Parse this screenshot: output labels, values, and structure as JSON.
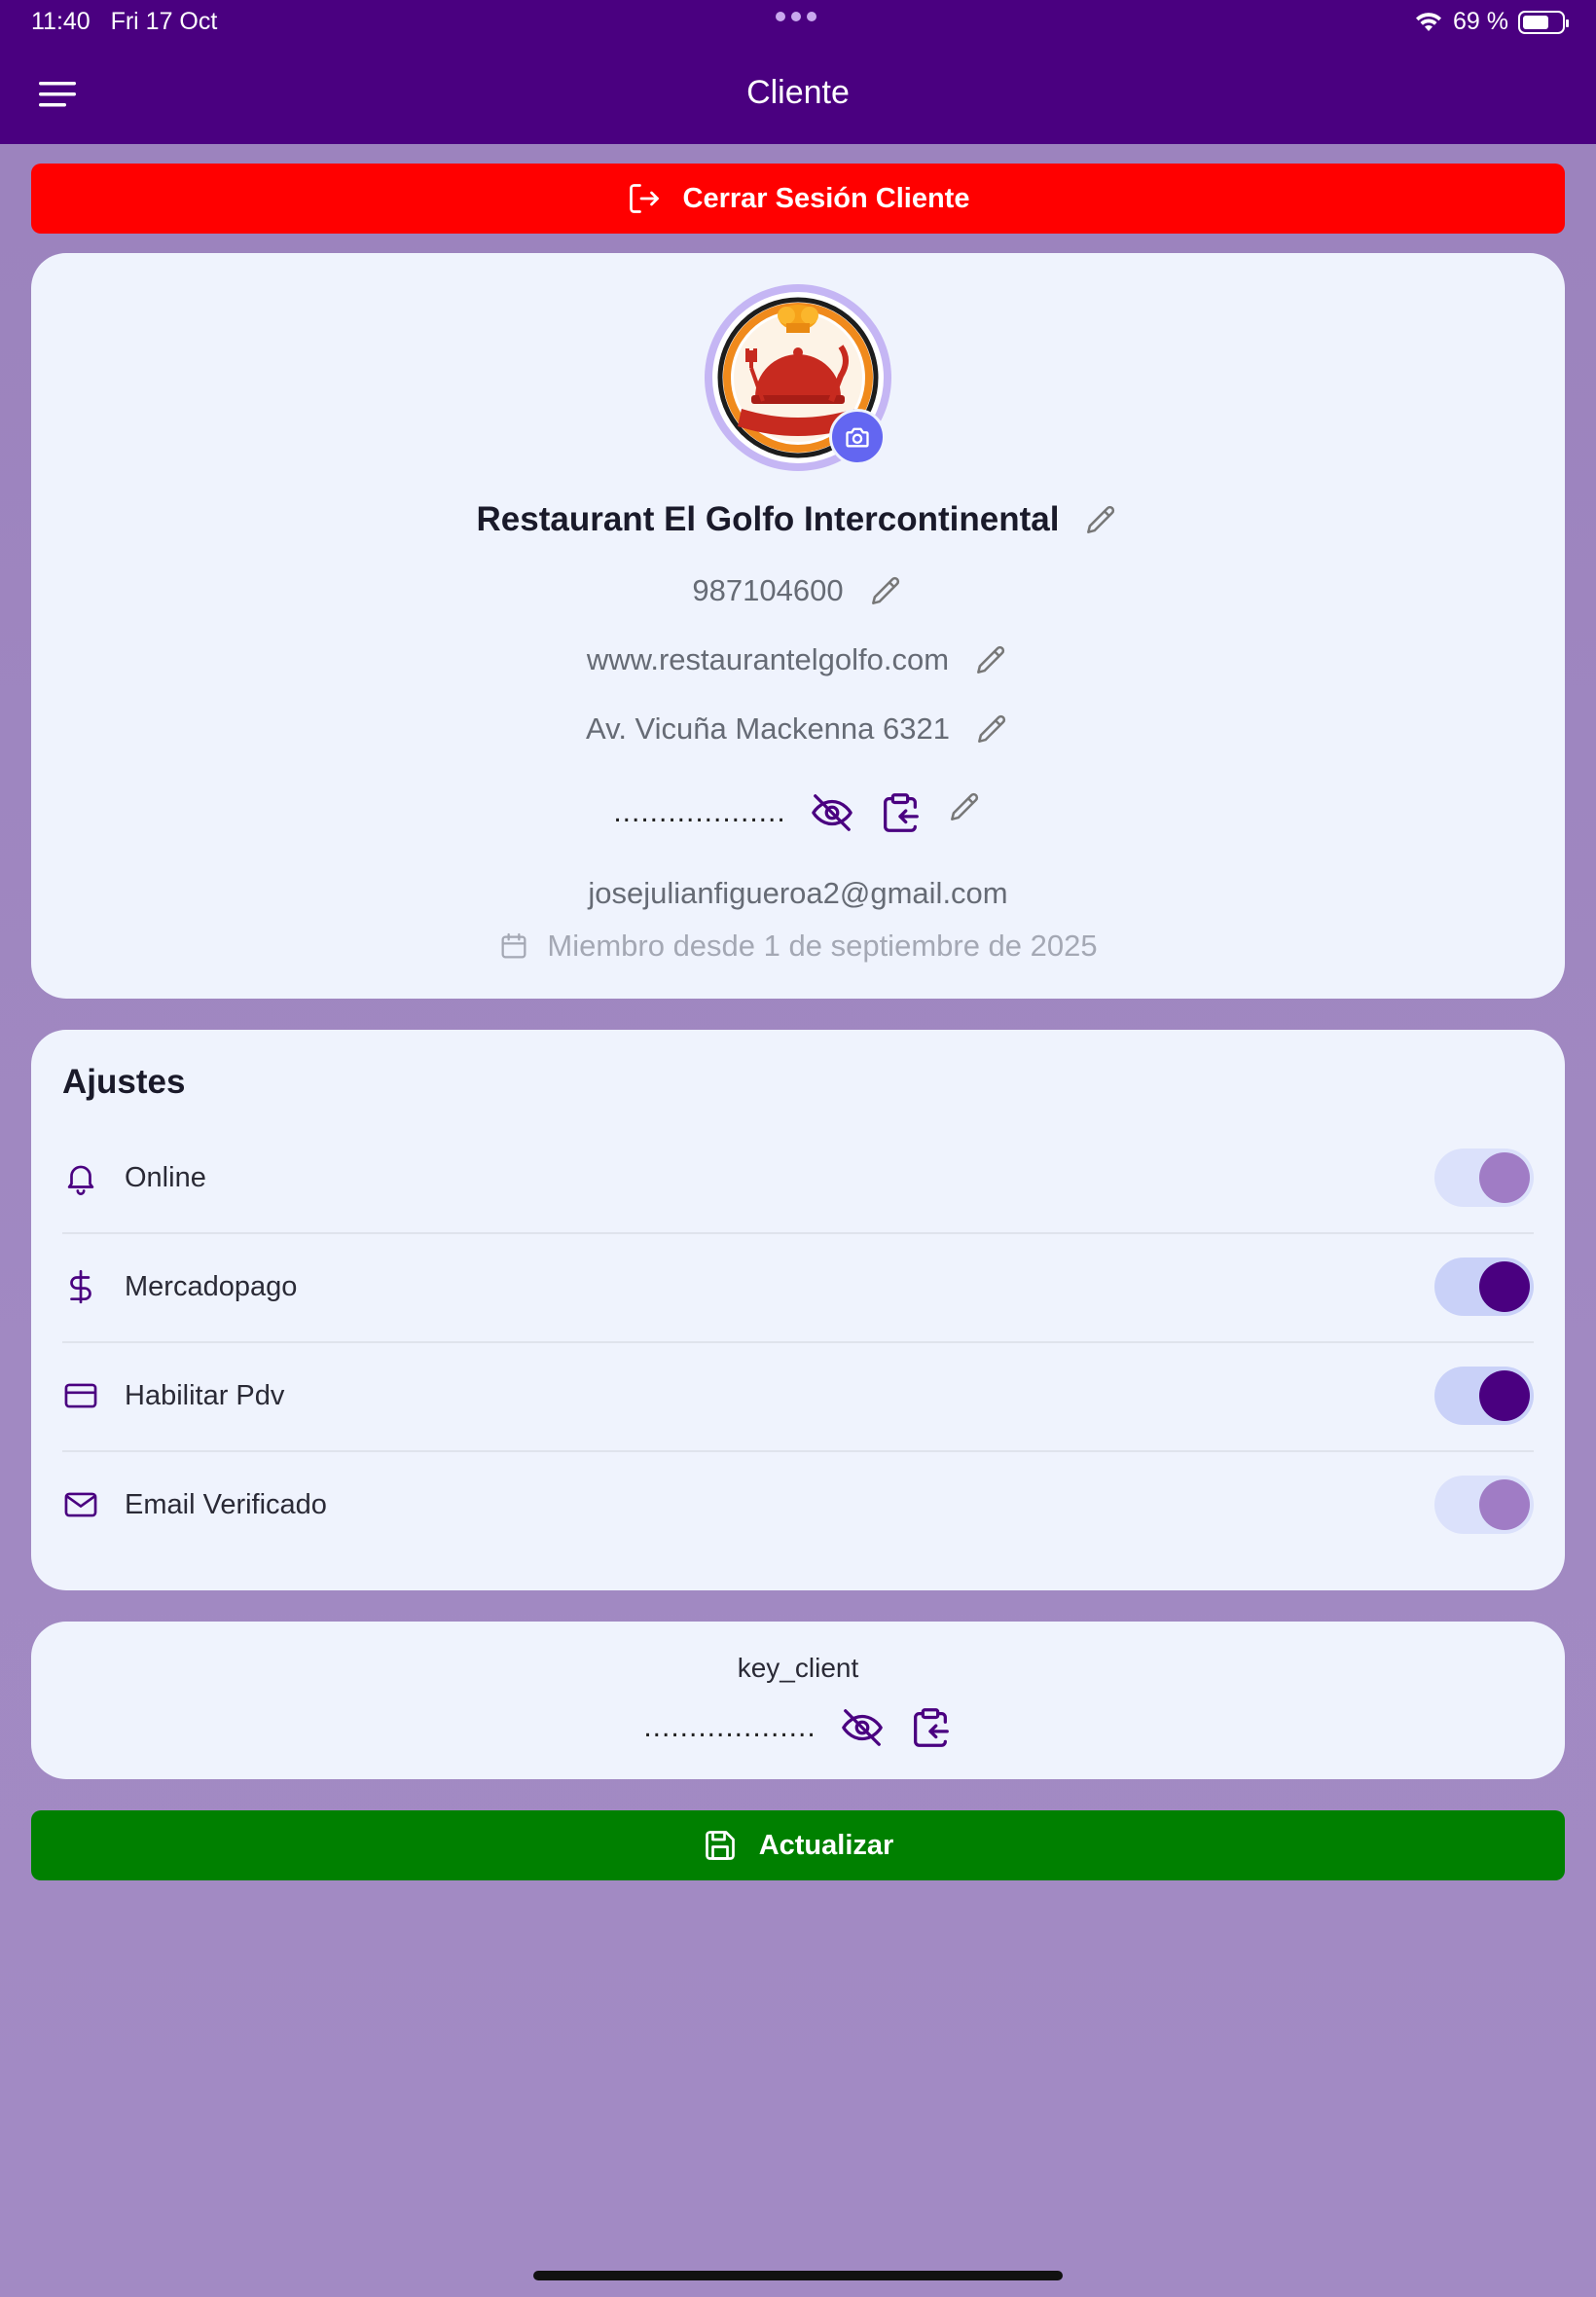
{
  "status_bar": {
    "time": "11:40",
    "date": "Fri 17 Oct",
    "battery": "69 %",
    "battery_level": 0.69
  },
  "header": {
    "title": "Cliente"
  },
  "logout_button": {
    "label": "Cerrar Sesión Cliente"
  },
  "profile": {
    "name": "Restaurant El Golfo Intercontinental",
    "phone": "987104600",
    "website": "www.restaurantelgolfo.com",
    "address": "Av. Vicuña Mackenna 6321",
    "password_mask": "...................",
    "email": "josejulianfigueroa2@gmail.com",
    "member_since": "Miembro desde 1 de septiembre de 2025"
  },
  "settings": {
    "title": "Ajustes",
    "items": [
      {
        "label": "Online",
        "icon": "bell-icon",
        "enabled": false
      },
      {
        "label": "Mercadopago",
        "icon": "dollar-icon",
        "enabled": true
      },
      {
        "label": "Habilitar Pdv",
        "icon": "credit-card-icon",
        "enabled": true
      },
      {
        "label": "Email Verificado",
        "icon": "mail-icon",
        "enabled": false
      }
    ]
  },
  "key_client": {
    "label": "key_client",
    "mask": "..................."
  },
  "update_button": {
    "label": "Actualizar"
  },
  "colors": {
    "header": "#4a0080",
    "logout": "#ff0000",
    "update": "#008000",
    "accent": "#4a0080",
    "toggle_off": "#a07cc5"
  }
}
